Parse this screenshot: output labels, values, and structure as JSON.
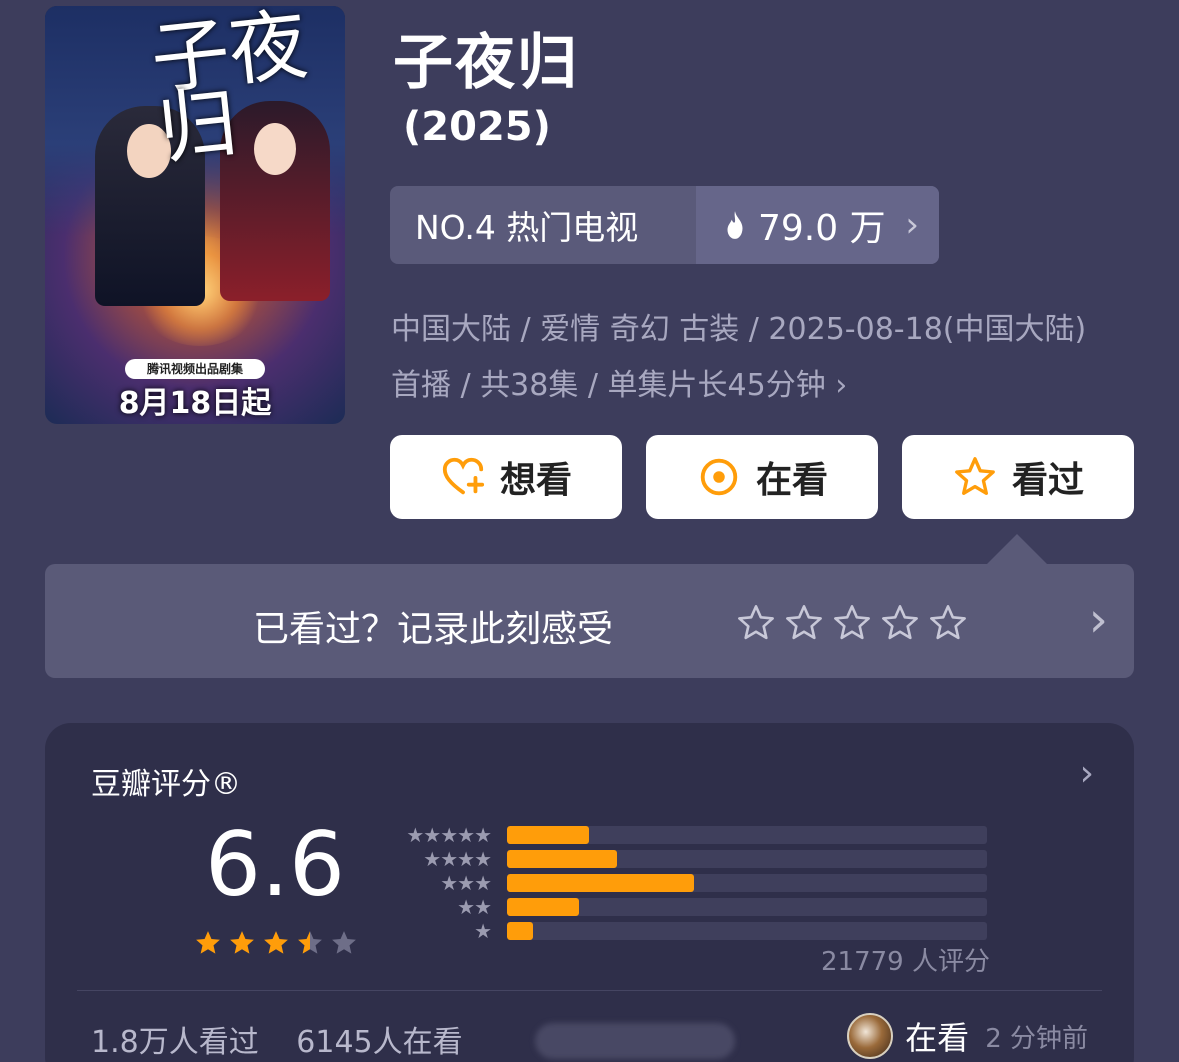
{
  "poster": {
    "title_art": "子夜归",
    "badge": "腾讯视频出品剧集",
    "date_text": "8月18日起"
  },
  "title": "子夜归",
  "year": "(2025)",
  "rank": {
    "label": "NO.4 热门电视",
    "heat": "79.0 万",
    "fire_icon": "fire-icon"
  },
  "meta": {
    "text": "中国大陆 / 爱情 奇幻 古装 / 2025-08-18(中国大陆) 首播 / 共38集 / 单集片长45分钟"
  },
  "actions": [
    {
      "label": "想看",
      "icon": "heart-plus-icon"
    },
    {
      "label": "在看",
      "icon": "watching-icon"
    },
    {
      "label": "看过",
      "icon": "star-icon"
    }
  ],
  "record": {
    "text": "已看过？记录此刻感受",
    "star_count": 5
  },
  "rating": {
    "header": "豆瓣评分®",
    "score": "6.6",
    "score_stars": 3.5,
    "count": "21779 人评分",
    "distribution": [
      {
        "stars": 5,
        "fraction": 0.17
      },
      {
        "stars": 4,
        "fraction": 0.23
      },
      {
        "stars": 3,
        "fraction": 0.39
      },
      {
        "stars": 2,
        "fraction": 0.15
      },
      {
        "stars": 1,
        "fraction": 0.055
      }
    ],
    "watched": "1.8万人看过",
    "watching": "6145人在看",
    "activity_label": "在看",
    "activity_time": "2 分钟前"
  },
  "colors": {
    "background": "#3d3d5c",
    "accent": "#ff9d0a",
    "card": "#2f2f4a"
  }
}
